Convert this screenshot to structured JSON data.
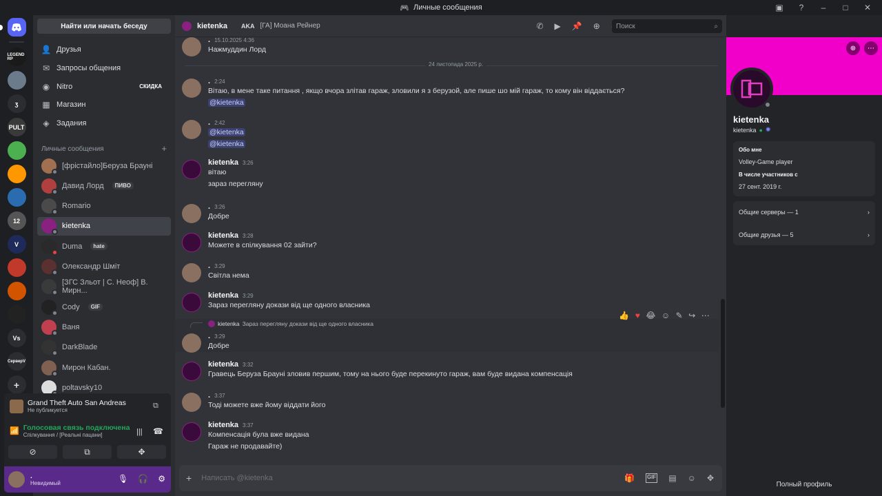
{
  "window": {
    "title": "Личные сообщения"
  },
  "guilds": [
    {
      "label": "LEGEND RP",
      "color": "#1a1a1a"
    },
    {
      "label": "",
      "color": "#6b7b8c"
    },
    {
      "label": "ʒ",
      "color": "#2b2d31"
    },
    {
      "label": "PULT",
      "color": "#3a3a3a"
    },
    {
      "label": "",
      "color": "#4caf50"
    },
    {
      "label": "",
      "color": "#ff9800"
    },
    {
      "label": "",
      "color": "#2b6cb0"
    },
    {
      "label": "12",
      "color": "#555"
    },
    {
      "label": "V",
      "color": "#1e2a5a"
    },
    {
      "label": "",
      "color": "#c0392b"
    },
    {
      "label": "",
      "color": "#d35400"
    },
    {
      "label": "",
      "color": "#222"
    },
    {
      "label": "Vs",
      "color": "#2b2d31"
    },
    {
      "label": "СерверV",
      "color": "#2b2d31"
    }
  ],
  "sidebar": {
    "search": "Найти или начать беседу",
    "nav": [
      {
        "label": "Друзья",
        "icon": "friends-icon"
      },
      {
        "label": "Запросы общения",
        "icon": "mail-icon"
      },
      {
        "label": "Nitro",
        "icon": "nitro-icon",
        "badge": "СКИДКА"
      },
      {
        "label": "Магазин",
        "icon": "shop-icon"
      },
      {
        "label": "Задания",
        "icon": "quests-icon"
      }
    ],
    "dm_header": "Личные сообщения",
    "dms": [
      {
        "name": "[фрістайло]Беруза Брауні",
        "color": "#a07050",
        "status": "offline"
      },
      {
        "name": "Давид Лорд",
        "tag": "ПИВО",
        "color": "#b04040",
        "status": "offline"
      },
      {
        "name": "Romario",
        "color": "#4a4a4a",
        "status": "offline"
      },
      {
        "name": "kietenka",
        "color": "#8a2080",
        "status": "offline",
        "selected": true
      },
      {
        "name": "Duma",
        "tag": "hate",
        "color": "#2a2a2a",
        "status": "dnd"
      },
      {
        "name": "Олександр Шміт",
        "color": "#5a3030",
        "status": "offline"
      },
      {
        "name": "[ЗГС Зльот | С. Неоф] В. Мирн...",
        "color": "#3a3a3a",
        "status": "offline"
      },
      {
        "name": "Cody",
        "tag": "GIF",
        "color": "#222",
        "status": "offline"
      },
      {
        "name": "Ваня",
        "color": "#c04050",
        "status": "offline"
      },
      {
        "name": "DarkBlade",
        "color": "#333",
        "status": "offline"
      },
      {
        "name": "Мирон Кабан.",
        "color": "#806050",
        "status": "offline"
      },
      {
        "name": "poltavsky10",
        "color": "#ddd",
        "status": "offline"
      }
    ]
  },
  "game": {
    "title": "Grand Theft Auto San Andreas",
    "sub": "Не публикуется"
  },
  "voice": {
    "title": "Голосовая связь подключена",
    "sub": "Спілкування / [Реальні пацани]"
  },
  "user": {
    "name": ".",
    "status": "Невидимый"
  },
  "chat": {
    "name": "kietenka",
    "aka": "AKA",
    "alt": "[ГА] Моана Рейнер",
    "search": "Поиск",
    "date_divider": "24 листопада 2025 р.",
    "placeholder": "Написать @kietenka",
    "messages": [
      {
        "user": ".",
        "time": "15.10.2025 4:36",
        "lines": [
          "Нажмуддин Лорд"
        ],
        "me": true
      },
      {
        "user": ".",
        "time": "2:24",
        "lines": [
          "Вітаю, в мене таке питання , якщо вчора злітав гараж, зловили я з берузой, але пише шо мій гараж, то кому він віддається?",
          "@kietenka"
        ],
        "me": true
      },
      {
        "user": ".",
        "time": "2:42",
        "lines": [
          "@kietenka",
          "@kietenka"
        ],
        "me": true
      },
      {
        "user": "kietenka",
        "time": "3:26",
        "lines": [
          "вітаю",
          "зараз перегляну"
        ],
        "me": false
      },
      {
        "user": ".",
        "time": "3:26",
        "lines": [
          "Добре"
        ],
        "me": true
      },
      {
        "user": "kietenka",
        "time": "3:28",
        "lines": [
          "Можете в спілкування 02 зайти?"
        ],
        "me": false
      },
      {
        "user": ".",
        "time": "3:29",
        "lines": [
          "Світла нема"
        ],
        "me": true
      },
      {
        "user": "kietenka",
        "time": "3:29",
        "lines": [
          "Зараз перегляну докази від ще одного власника"
        ],
        "me": false
      },
      {
        "user": ".",
        "time": "3:29",
        "lines": [
          "Добре"
        ],
        "me": true,
        "reply_user": "kietenka",
        "reply_text": "Зараз перегляну докази від ще одного власника"
      },
      {
        "user": "kietenka",
        "time": "3:32",
        "lines": [
          "Гравець Беруза Брауні зловив першим, тому на нього буде перекинуто гараж, вам буде видана компенсація"
        ],
        "me": false
      },
      {
        "user": ".",
        "time": "3:37",
        "lines": [
          "Тоді можете вже йому віддати його"
        ],
        "me": true
      },
      {
        "user": "kietenka",
        "time": "3:37",
        "lines": [
          "Компенсація була вже видана",
          "Гараж не продавайте)"
        ],
        "me": false
      }
    ]
  },
  "profile": {
    "name": "kietenka",
    "username": "kietenka",
    "about_h": "Обо мне",
    "about_v": "Volley-Game player",
    "member_h": "В числе участников с",
    "member_v": "27 сент. 2019 г.",
    "servers": "Общие серверы — 1",
    "friends": "Общие друзья — 5",
    "full": "Полный профиль"
  },
  "colors": {
    "accent": "#5865f2",
    "banner": "#f000c8",
    "user_panel": "#5a2a8a",
    "voice_green": "#23a55a"
  }
}
